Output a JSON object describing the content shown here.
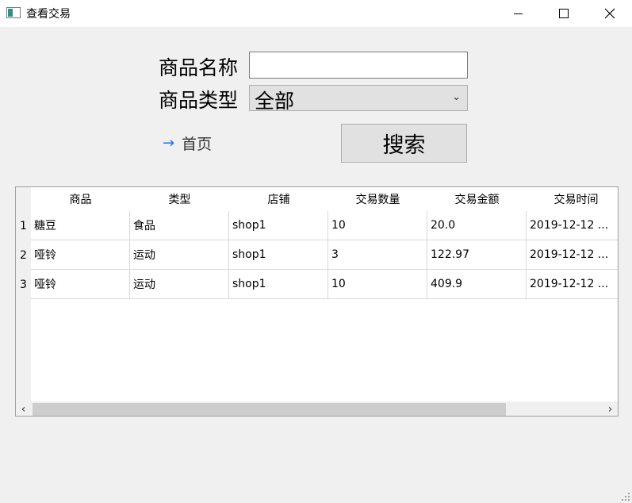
{
  "window": {
    "title": "查看交易",
    "icon": "app-window-icon"
  },
  "form": {
    "name_label": "商品名称",
    "name_value": "",
    "type_label": "商品类型",
    "type_selected": "全部",
    "home_label": "首页",
    "search_label": "搜索"
  },
  "table": {
    "headers": [
      "商品",
      "类型",
      "店铺",
      "交易数量",
      "交易金额",
      "交易时间"
    ],
    "rows": [
      {
        "num": "1",
        "cells": [
          "糖豆",
          "食品",
          "shop1",
          "10",
          "20.0",
          "2019-12-12 ..."
        ]
      },
      {
        "num": "2",
        "cells": [
          "哑铃",
          "运动",
          "shop1",
          "3",
          "122.97",
          "2019-12-12 ..."
        ]
      },
      {
        "num": "3",
        "cells": [
          "哑铃",
          "运动",
          "shop1",
          "10",
          "409.9",
          "2019-12-12 ..."
        ]
      }
    ]
  },
  "colors": {
    "accent": "#1a73e8",
    "background": "#f0f0f0"
  }
}
